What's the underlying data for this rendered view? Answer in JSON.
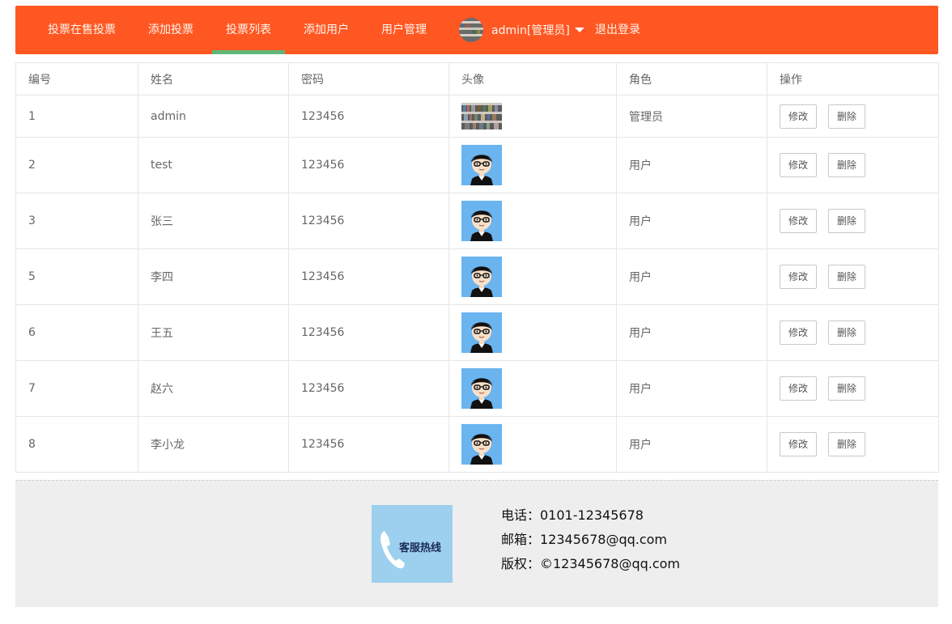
{
  "nav": {
    "items": [
      {
        "label": "投票在售投票",
        "active": false
      },
      {
        "label": "添加投票",
        "active": false
      },
      {
        "label": "投票列表",
        "active": true
      },
      {
        "label": "添加用户",
        "active": false
      },
      {
        "label": "用户管理",
        "active": false
      }
    ],
    "user_label": "admin[管理员]",
    "logout_label": "退出登录"
  },
  "table": {
    "headers": [
      "编号",
      "姓名",
      "密码",
      "头像",
      "角色",
      "操作"
    ],
    "rows": [
      {
        "id": "1",
        "name": "admin",
        "password": "123456",
        "avatar": "bookshelf-photo",
        "role": "管理员"
      },
      {
        "id": "2",
        "name": "test",
        "password": "123456",
        "avatar": "cartoon-boy",
        "role": "用户"
      },
      {
        "id": "3",
        "name": "张三",
        "password": "123456",
        "avatar": "cartoon-boy",
        "role": "用户"
      },
      {
        "id": "5",
        "name": "李四",
        "password": "123456",
        "avatar": "cartoon-boy",
        "role": "用户"
      },
      {
        "id": "6",
        "name": "王五",
        "password": "123456",
        "avatar": "cartoon-boy",
        "role": "用户"
      },
      {
        "id": "7",
        "name": "赵六",
        "password": "123456",
        "avatar": "cartoon-boy",
        "role": "用户"
      },
      {
        "id": "8",
        "name": "李小龙",
        "password": "123456",
        "avatar": "cartoon-boy",
        "role": "用户"
      }
    ],
    "edit_label": "修改",
    "delete_label": "删除"
  },
  "footer": {
    "hotline_label": "客服热线",
    "phone": "电话：0101-12345678",
    "email": "邮箱：12345678@qq.com",
    "copyright": "版权：©12345678@qq.com"
  },
  "colors": {
    "nav_bg": "#ff5722",
    "active_indicator": "#5fb878",
    "hotline_bg": "#9dcfee",
    "footer_bg": "#eeeeee"
  }
}
